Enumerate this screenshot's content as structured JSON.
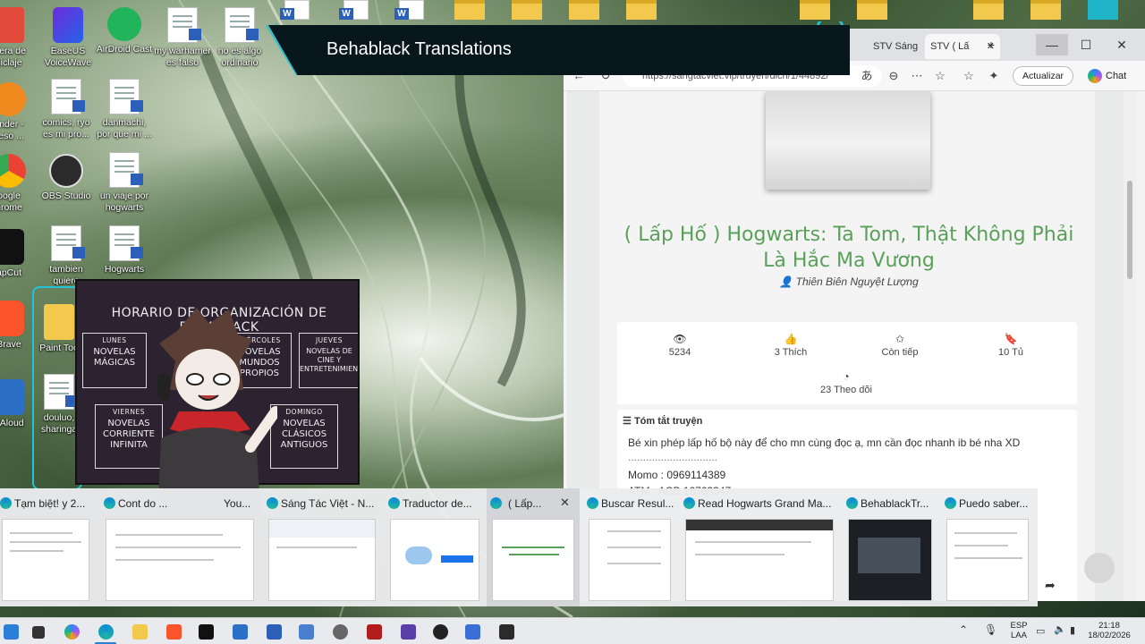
{
  "overlay": {
    "banner_title": "Behablack Translations"
  },
  "desktop_icons": [
    {
      "label": "elera de\nciclaje"
    },
    {
      "label": "EaseUS\nVoiceWave"
    },
    {
      "label": "AirDroid Cast"
    },
    {
      "label": "my warhamer\nes falso"
    },
    {
      "label": "no es algo\nordinario"
    },
    {
      "label": "ender -\nceso ..."
    },
    {
      "label": "comics, ryo\nes mi pro..."
    },
    {
      "label": "danmachi,\npor que mi ..."
    },
    {
      "label": "oogle\nhrome"
    },
    {
      "label": "OBS Studio"
    },
    {
      "label": "un viaje por\nhogwarts"
    },
    {
      "label": "apCut"
    },
    {
      "label": "tambien\nquiere"
    },
    {
      "label": "Hogwarts"
    },
    {
      "label": "Brave"
    },
    {
      "label": "Paint Too"
    },
    {
      "label": "rtAloud"
    },
    {
      "label": "douluo,\nsharinga"
    }
  ],
  "browser": {
    "tabs": [
      "STV Sáng Tá",
      "STV ( Lấ"
    ],
    "url": "https://sangtacviet.vip/truyen/dich/1/44892/",
    "update_label": "Actualizar",
    "chat_label": "Chat"
  },
  "book": {
    "title": "( Lấp Hố ) Hogwarts: Ta Tom, Thật Không Phải Là Hắc Ma Vương",
    "author": "Thiên Biên Nguyệt Lượng",
    "stats": {
      "views": "5234",
      "likes": "3 Thích",
      "status": "Còn tiếp",
      "shelf": "10 Tủ",
      "followers": "23 Theo dõi"
    },
    "summary_heading": "Tóm tắt truyện",
    "summary_lines": [
      "Bé xin phép lấp hố bộ này để cho mn cùng đọc ạ, mn cần đọc nhanh ib bé nha XD",
      "..............................",
      "Momo : 0969114389",
      "ATM : ACB 16763347"
    ]
  },
  "schedule": {
    "title": "HORARIO DE ORGANIZACIÓN DE BEHABLACK",
    "days": [
      {
        "day": "LUNES",
        "topic": "NOVELAS MÁGICAS"
      },
      {
        "day": "MIÉRCOLES",
        "topic": "NOVELAS MUNDOS PROPIOS"
      },
      {
        "day": "JUEVES",
        "topic": "NOVELAS DE CINE Y ENTRETENIMIENTO"
      },
      {
        "day": "VIERNES",
        "topic": "NOVELAS CORRIENTE INFINITA"
      },
      {
        "day": "DOMINGO",
        "topic": "NOVELAS CLÁSICOS ANTIGUOS"
      }
    ]
  },
  "task_view": [
    {
      "title": "Tạm biệt! y 2..."
    },
    {
      "title": "Cont    do ..."
    },
    {
      "title": "You..."
    },
    {
      "title": "Sáng Tác Việt - N..."
    },
    {
      "title": "Traductor de..."
    },
    {
      "title": "( Lấp..."
    },
    {
      "title": "Buscar Resul..."
    },
    {
      "title": "Read Hogwarts Grand Ma..."
    },
    {
      "title": "BehablackTr..."
    },
    {
      "title": "Puedo saber..."
    }
  ],
  "taskbar": {
    "lang_top": "ESP",
    "lang_bottom": "LAA",
    "time": "21:18",
    "date": "18/02/2026"
  },
  "colors": {
    "title_green": "#5aa05a",
    "banner_bg": "#08171c",
    "accent_cyan": "#22c3d6"
  }
}
